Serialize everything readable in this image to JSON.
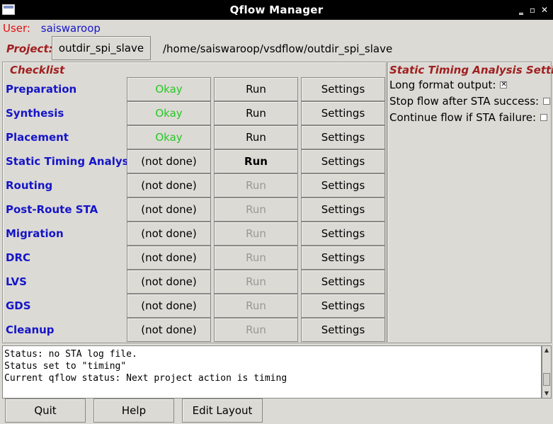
{
  "window": {
    "title": "Qflow Manager"
  },
  "user": {
    "label": "User:",
    "name": "saiswaroop"
  },
  "project": {
    "label": "Project:",
    "button": "outdir_spi_slave",
    "path": "/home/saiswaroop/vsdflow/outdir_spi_slave"
  },
  "checklist": {
    "title": "Checklist",
    "steps": [
      {
        "name": "Preparation",
        "status": "Okay",
        "run": "Run",
        "settings": "Settings"
      },
      {
        "name": "Synthesis",
        "status": "Okay",
        "run": "Run",
        "settings": "Settings"
      },
      {
        "name": "Placement",
        "status": "Okay",
        "run": "Run",
        "settings": "Settings"
      },
      {
        "name": "Static Timing Analysis",
        "status": "(not done)",
        "run": "Run",
        "settings": "Settings"
      },
      {
        "name": "Routing",
        "status": "(not done)",
        "run": "Run",
        "settings": "Settings"
      },
      {
        "name": "Post-Route STA",
        "status": "(not done)",
        "run": "Run",
        "settings": "Settings"
      },
      {
        "name": "Migration",
        "status": "(not done)",
        "run": "Run",
        "settings": "Settings"
      },
      {
        "name": "DRC",
        "status": "(not done)",
        "run": "Run",
        "settings": "Settings"
      },
      {
        "name": "LVS",
        "status": "(not done)",
        "run": "Run",
        "settings": "Settings"
      },
      {
        "name": "GDS",
        "status": "(not done)",
        "run": "Run",
        "settings": "Settings"
      },
      {
        "name": "Cleanup",
        "status": "(not done)",
        "run": "Run",
        "settings": "Settings"
      }
    ]
  },
  "sta_settings": {
    "title": "Static Timing Analysis Settings",
    "options": [
      {
        "label": "Long format output:",
        "checked": true
      },
      {
        "label": "Stop flow after STA success:",
        "checked": false
      },
      {
        "label": "Continue flow if STA failure:",
        "checked": false
      }
    ]
  },
  "log": {
    "lines": [
      "Status: no STA log file.",
      "Status set to \"timing\"",
      "Current qflow status:  Next project action is timing"
    ]
  },
  "buttons": {
    "quit": "Quit",
    "help": "Help",
    "edit_layout": "Edit Layout"
  },
  "colors": {
    "okay": "#25c825",
    "step_label": "#1515c8",
    "section_title": "#a02020",
    "user_label": "#e01010"
  }
}
